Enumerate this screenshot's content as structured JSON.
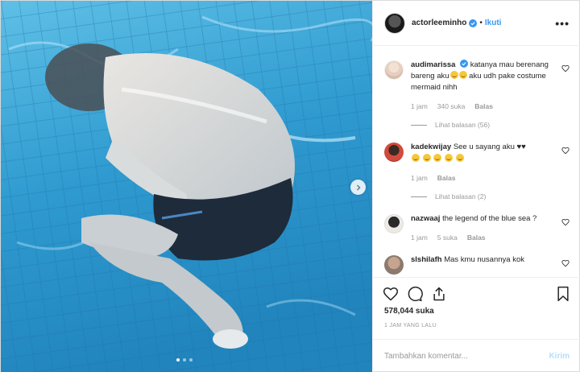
{
  "post": {
    "username": "actorleeminho",
    "separator": "•",
    "follow_label": "Ikuti",
    "more_label": "•••",
    "accent_color": "#3897f0",
    "carousel": {
      "slides": 3,
      "active": 1
    },
    "likes": "578,044 suka",
    "time_ago": "1 JAM YANG LALU",
    "comment_placeholder": "Tambahkan komentar...",
    "post_label": "Kirim"
  },
  "comments": [
    {
      "user": "audimarissa",
      "verified": true,
      "text": "katanya mau berenang bareng aku",
      "text2": " aku udh pake costume mermaid nihh",
      "time": "1 jam",
      "likes": "340 suka",
      "reply": "Balas",
      "views": "Lihat balasan (56)"
    },
    {
      "user": "kadekwijay",
      "verified": false,
      "text": "See u sayang aku ♥♥",
      "time": "1 jam",
      "reply": "Balas",
      "views": "Lihat balasan (2)"
    },
    {
      "user": "nazwaaj",
      "verified": false,
      "text": "the legend of the blue sea ?",
      "time": "1 jam",
      "likes": "5 suka",
      "reply": "Balas"
    },
    {
      "user": "slshilafh",
      "verified": false,
      "text": "Mas kmu nusannya kok"
    }
  ]
}
